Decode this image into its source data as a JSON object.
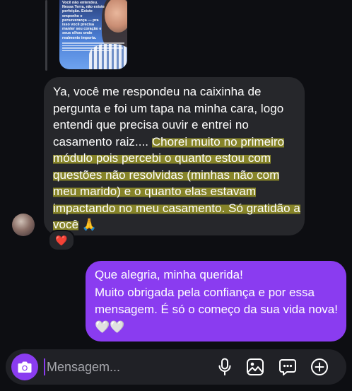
{
  "story_reply": {
    "story_text": "Você não entendeu. Nessa Terra, não existe perfeição. Existe empenho e perseverança — pra isso você precisa manter seu coração e seus olhos onde realmente importa."
  },
  "received_message": {
    "text_plain": "Ya, você me respondeu na caixinha de pergunta e foi um tapa na minha cara, logo entendi que precisa ouvir e entrei no casamento raiz.... ",
    "text_highlight_1": "Chorei muito no primeiro módulo pois percebi o quanto estou com questões não resolvidas (minhas não com meu marido) e o quanto elas estavam impactando no meu casamento. Só gratidão a você",
    "text_emoji": " 🙏",
    "reaction": "❤️"
  },
  "sent_message": {
    "line1": "Que alegria, minha querida!",
    "line2": "Muito obrigada pela confiança e por essa mensagem. É só o começo da sua vida nova! 🤍🤍"
  },
  "composer": {
    "placeholder": "Mensagem..."
  },
  "icons": {
    "camera": "camera-icon",
    "mic": "microphone-icon",
    "gallery": "image-icon",
    "sticker": "chat-bubble-icon",
    "plus": "plus-circle-icon"
  },
  "colors": {
    "background": "#0d0e12",
    "received_bubble": "#26272b",
    "sent_bubble": "#8a3cf0",
    "highlight": "#d6d028"
  }
}
